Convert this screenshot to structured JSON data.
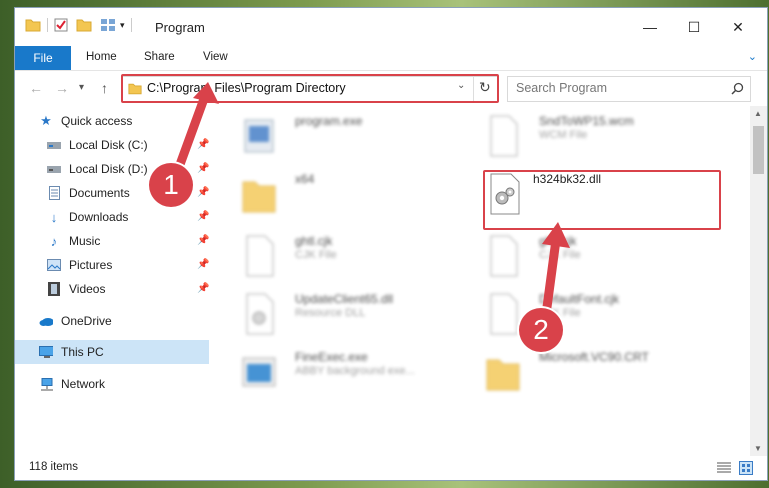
{
  "window": {
    "title": "Program"
  },
  "ribbon": {
    "tabs": [
      "File",
      "Home",
      "Share",
      "View"
    ]
  },
  "address": {
    "path": "C:\\Program Files\\Program Directory"
  },
  "search": {
    "placeholder": "Search Program"
  },
  "sidebar": {
    "items": [
      {
        "label": "Quick access"
      },
      {
        "label": "Local Disk (C:)"
      },
      {
        "label": "Local Disk (D:)"
      },
      {
        "label": "Documents"
      },
      {
        "label": "Downloads"
      },
      {
        "label": "Music"
      },
      {
        "label": "Pictures"
      },
      {
        "label": "Videos"
      },
      {
        "label": "OneDrive"
      },
      {
        "label": "This PC"
      },
      {
        "label": "Network"
      }
    ]
  },
  "files": [
    {
      "name": "program.exe",
      "sub": ""
    },
    {
      "name": "SndToWP15.wcm",
      "sub": "WCM File"
    },
    {
      "name": "x64",
      "sub": ""
    },
    {
      "name": "h324bk32.dll",
      "sub": ""
    },
    {
      "name": "ghtl.cjk",
      "sub": "CJK File"
    },
    {
      "name": "ghtl.cjk",
      "sub": "CJK File"
    },
    {
      "name": "UpdateClient65.dll",
      "sub": "Resource DLL"
    },
    {
      "name": "DefaultFont.cjk",
      "sub": "CJK File"
    },
    {
      "name": "FineExec.exe",
      "sub": "ABBY background exe..."
    },
    {
      "name": "Microsoft.VC90.CRT",
      "sub": ""
    }
  ],
  "status": {
    "items_count": "118 items"
  },
  "annotations": {
    "step1": "1",
    "step2": "2"
  },
  "colors": {
    "accent": "#1979ca",
    "highlight": "#d9424a"
  }
}
